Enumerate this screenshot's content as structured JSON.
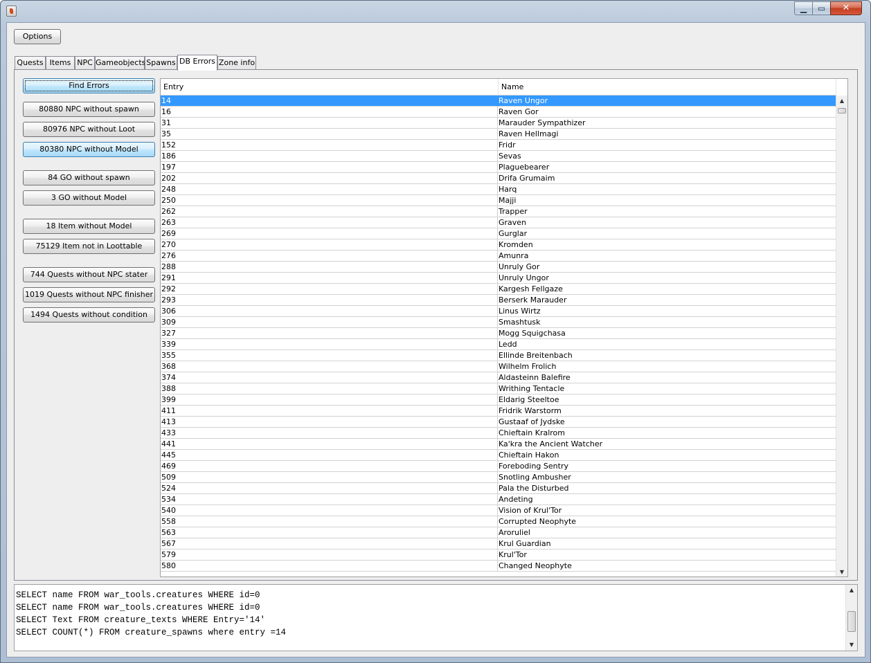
{
  "window": {
    "title": "",
    "controls": {
      "minimize": "▁",
      "maximize": "▭",
      "close": "✕"
    },
    "icon": "java-cup-icon"
  },
  "toolbar": {
    "options_label": "Options"
  },
  "tabs": [
    "Quests",
    "Items",
    "NPC",
    "Gameobjects",
    "Spawns",
    "DB Errors",
    "Zone info"
  ],
  "active_tab": "DB Errors",
  "sidebar": {
    "find_errors": "Find Errors",
    "buttons": [
      "80880 NPC without spawn",
      "80976 NPC without Loot",
      "80380 NPC without Model",
      "84 GO without spawn",
      "3 GO without Model",
      "18 Item without Model",
      "75129 Item not in Loottable",
      "744 Quests without NPC stater",
      "1019 Quests without NPC finisher",
      "1494 Quests without condition"
    ]
  },
  "table": {
    "columns": [
      "Entry",
      "Name"
    ],
    "selected_index": 0,
    "rows": [
      [
        "14",
        "Raven Ungor"
      ],
      [
        "16",
        "Raven Gor"
      ],
      [
        "31",
        "Marauder Sympathizer"
      ],
      [
        "35",
        "Raven Hellmagi"
      ],
      [
        "152",
        "Fridr"
      ],
      [
        "186",
        "Sevas"
      ],
      [
        "197",
        "Plaguebearer"
      ],
      [
        "202",
        "Drifa Grumaim"
      ],
      [
        "248",
        "Harq"
      ],
      [
        "250",
        "Majji"
      ],
      [
        "262",
        "Trapper"
      ],
      [
        "263",
        "Graven"
      ],
      [
        "269",
        "Gurglar"
      ],
      [
        "270",
        "Kromden"
      ],
      [
        "276",
        "Amunra"
      ],
      [
        "288",
        "Unruly Gor"
      ],
      [
        "291",
        "Unruly Ungor"
      ],
      [
        "292",
        "Kargesh Fellgaze"
      ],
      [
        "293",
        "Berserk Marauder"
      ],
      [
        "306",
        "Linus Wirtz"
      ],
      [
        "309",
        "Smashtusk"
      ],
      [
        "327",
        "Mogg Squigchasa"
      ],
      [
        "339",
        "Ledd"
      ],
      [
        "355",
        "Ellinde Breitenbach"
      ],
      [
        "368",
        "Wilhelm Frolich"
      ],
      [
        "374",
        "Aldasteinn Balefire"
      ],
      [
        "388",
        "Writhing Tentacle"
      ],
      [
        "399",
        "Eldarig Steeltoe"
      ],
      [
        "411",
        "Fridrik Warstorm"
      ],
      [
        "413",
        "Gustaaf of Jydske"
      ],
      [
        "433",
        "Chieftain Kralrom"
      ],
      [
        "441",
        "Ka'kra the Ancient Watcher"
      ],
      [
        "445",
        "Chieftain Hakon"
      ],
      [
        "469",
        "Foreboding Sentry"
      ],
      [
        "509",
        "Snotling Ambusher"
      ],
      [
        "524",
        "Pala the Disturbed"
      ],
      [
        "534",
        "Andeting"
      ],
      [
        "540",
        "Vision of Krul'Tor"
      ],
      [
        "558",
        "Corrupted Neophyte"
      ],
      [
        "563",
        "Aroruliel"
      ],
      [
        "567",
        "Krul Guardian"
      ],
      [
        "579",
        "Krul'Tor"
      ],
      [
        "580",
        "Changed Neophyte"
      ]
    ]
  },
  "console": {
    "lines": [
      "SELECT name FROM war_tools.creatures WHERE id=0",
      "SELECT name FROM war_tools.creatures WHERE id=0",
      "SELECT Text FROM creature_texts WHERE Entry='14'",
      "SELECT COUNT(*) FROM creature_spawns where entry =14"
    ]
  },
  "scroll": {
    "up_arrow": "▲",
    "down_arrow": "▼"
  }
}
